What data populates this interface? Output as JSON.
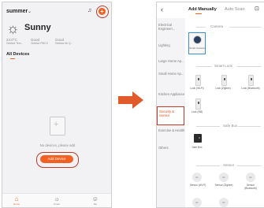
{
  "home": {
    "home_name": "summer",
    "weather": {
      "condition": "Sunny",
      "stats": [
        {
          "value": "24.0°C",
          "label": "Outdoor Tem..."
        },
        {
          "value": "Good",
          "label": "Outdoor PM2.5"
        },
        {
          "value": "Good",
          "label": "Outdoor Air Q..."
        }
      ]
    },
    "section_title": "All Devices",
    "empty_text": "No devices, please add",
    "add_device_label": "Add Device",
    "bottom_nav": [
      {
        "label": "Home",
        "icon": "home-icon"
      },
      {
        "label": "Smart",
        "icon": "smart-icon"
      },
      {
        "label": "Me",
        "icon": "me-icon"
      }
    ]
  },
  "add_manually": {
    "tabs": [
      "Add Manually",
      "Auto Scan"
    ],
    "categories": [
      "Electrical Engineeri...",
      "Lighting",
      "Large Home Ap...",
      "Small Home Ap...",
      "Kitchen Appliance",
      "Security & Sensor",
      "Exercise & Health",
      "Others"
    ],
    "selected_category": "Security & Sensor",
    "sections": {
      "camera": {
        "title": "Camera",
        "items": [
          "Smart Camera"
        ]
      },
      "smart_lock": {
        "title": "Smart Lock",
        "items": [
          "Lock (Wi-Fi)",
          "Lock (Zigbee)",
          "Lock (Bluetooth)",
          "Lock (NB)"
        ]
      },
      "safe_box": {
        "title": "Safe Box",
        "items": [
          "Safe Box"
        ]
      },
      "sensor": {
        "title": "Sensor",
        "items": [
          "Sensor (Wi-Fi)",
          "Sensor (Zigbee)",
          "Sensor (Bluetooth)"
        ],
        "icon_text": "3in"
      }
    }
  },
  "colors": {
    "accent": "#f26122",
    "highlight_ring": "#c13b2a",
    "arrow": "#e05a2a"
  }
}
